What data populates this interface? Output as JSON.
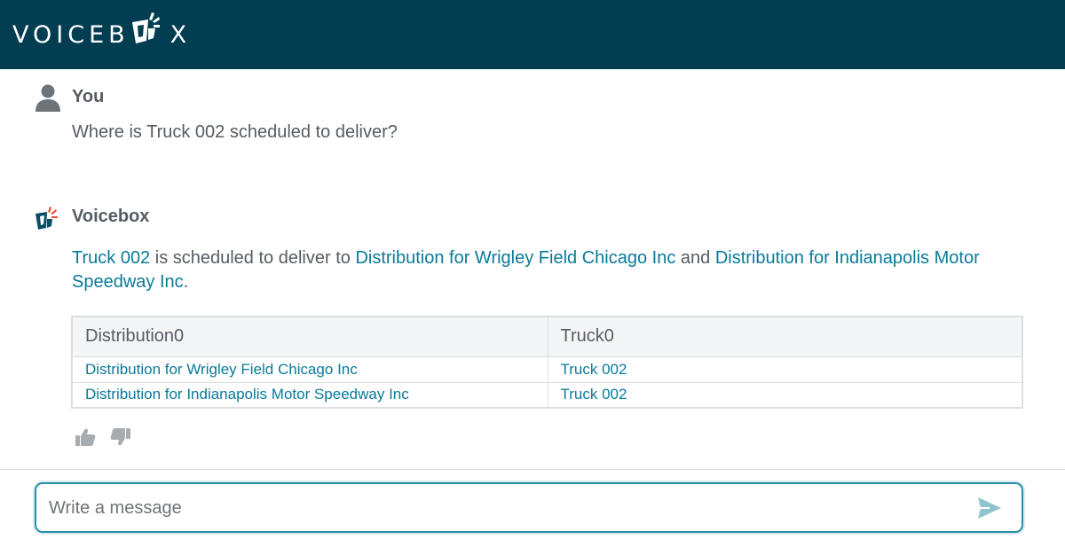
{
  "header": {
    "logo_text_left": "VOICEB",
    "logo_text_right": "X",
    "logo_icon": "voicebox-logo-icon",
    "background": "#023d52"
  },
  "user_message": {
    "sender": "You",
    "avatar_icon": "person-icon",
    "text": "Where is Truck 002 scheduled to deliver?"
  },
  "bot_message": {
    "sender": "Voicebox",
    "avatar_icon": "voicebox-logo-icon",
    "reply": {
      "link_truck": "Truck 002",
      "text_1": " is scheduled to deliver to ",
      "link_dist_1": "Distribution for Wrigley Field Chicago Inc",
      "text_2": " and ",
      "link_dist_2": "Distribution for Indianapolis Motor Speedway Inc",
      "text_3": "."
    },
    "table": {
      "headers": [
        "Distribution0",
        "Truck0"
      ],
      "rows": [
        [
          "Distribution for Wrigley Field Chicago Inc",
          "Truck 002"
        ],
        [
          "Distribution for Indianapolis Motor Speedway Inc",
          "Truck 002"
        ]
      ]
    },
    "feedback": {
      "up_icon": "thumbs-up-icon",
      "down_icon": "thumbs-down-icon"
    }
  },
  "composer": {
    "placeholder": "Write a message",
    "value": "",
    "send_icon": "send-icon"
  },
  "colors": {
    "accent": "#0a7a9a",
    "text": "#555c63",
    "header": "#023d52"
  }
}
